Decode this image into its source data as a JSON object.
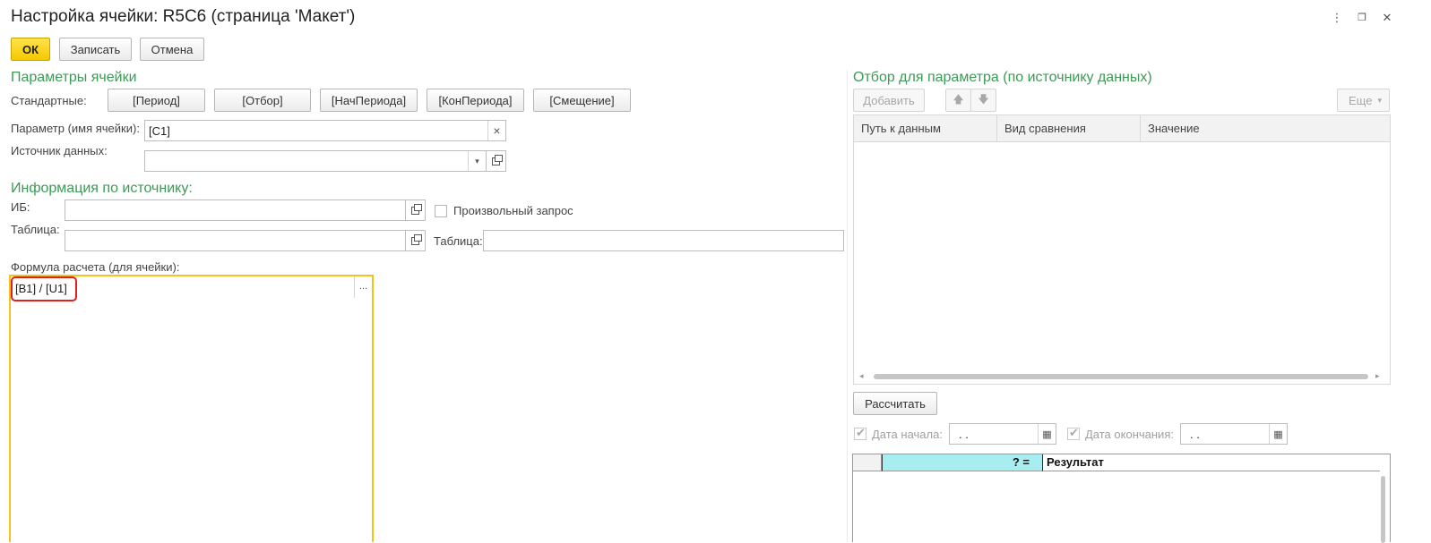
{
  "window": {
    "title": "Настройка ячейки: R5C6 (страница 'Макет')",
    "more_glyph": "⋮",
    "restore_glyph": "❐",
    "close_glyph": "✕"
  },
  "toolbar": {
    "ok": "ОК",
    "save": "Записать",
    "cancel": "Отмена"
  },
  "cell_params": {
    "title": "Параметры ячейки",
    "standard_label": "Стандартные:",
    "standard_buttons": [
      "[Период]",
      "[Отбор]",
      "[НачПериода]",
      "[КонПериода]",
      "[Смещение]"
    ],
    "param_label": "Параметр (имя ячейки):",
    "param_value": "[C1]",
    "clear_glyph": "×",
    "source_label": "Источник данных:",
    "source_value": "",
    "dropdown_glyph": "▾"
  },
  "source_info": {
    "title": "Информация по источнику:",
    "ib_label": "ИБ:",
    "ib_value": "",
    "arbitrary_query_label": "Произвольный запрос",
    "table_label": "Таблица:",
    "table_value": "",
    "table2_label": "Таблица:",
    "table2_value": ""
  },
  "formula": {
    "label": "Формула расчета (для ячейки):",
    "value": "[B1] / [U1]",
    "ellipsis": "...",
    "highlight_color": "#e02020",
    "border_color": "#f0c419"
  },
  "filter": {
    "title": "Отбор для параметра (по источнику данных)",
    "add_label": "Добавить",
    "up_glyph": "🡅",
    "down_glyph": "🡇",
    "more_label": "Еще",
    "more_glyph": "▾",
    "columns": [
      "Путь к данным",
      "Вид сравнения",
      "Значение"
    ],
    "scroll_left": "◂",
    "scroll_right": "▸"
  },
  "calc": {
    "button_label": "Рассчитать",
    "start_label": "Дата начала:",
    "start_value": ". .",
    "end_label": "Дата окончания:",
    "end_value": ". .",
    "calendar_glyph": "▦"
  },
  "result": {
    "col1": "? =",
    "col2": "Результат",
    "col1_color": "#a8eef0"
  }
}
